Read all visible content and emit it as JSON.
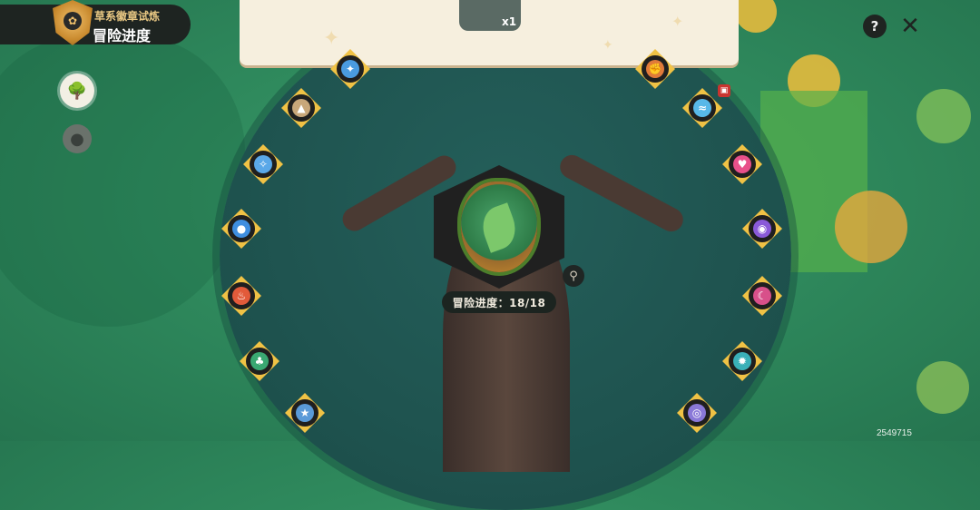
{
  "header": {
    "subtitle": "草系徽章试炼",
    "title": "冒险进度",
    "badge_icon": "leaf-badge-icon"
  },
  "side_menu": {
    "items": [
      {
        "icon": "tree-icon",
        "active": true
      },
      {
        "icon": "pokemon-silhouette-icon",
        "active": false
      }
    ]
  },
  "reward_card": {
    "item_icon": "badge-reward-icon",
    "quantity": "x1"
  },
  "top_controls": {
    "help_label": "?",
    "close_label": "✕"
  },
  "center": {
    "emblem_icon": "grass-badge-emblem",
    "progress_text": "冒险进度：18/18",
    "zoom_icon": "magnifier-icon"
  },
  "nodes": {
    "left": [
      {
        "icon": "electric-icon",
        "color": "#4a9be0"
      },
      {
        "icon": "rock-mountain-icon",
        "color": "#c8a77a"
      },
      {
        "icon": "ice-crystal-icon",
        "color": "#5aa8e8"
      },
      {
        "icon": "water-drop-icon",
        "color": "#3f8ee0"
      },
      {
        "icon": "fire-icon",
        "color": "#e25a3a"
      },
      {
        "icon": "grass-leaf-icon",
        "color": "#3aa872"
      },
      {
        "icon": "normal-star-icon",
        "color": "#5a9ad8"
      }
    ],
    "right": [
      {
        "icon": "fighting-icon",
        "color": "#e07a3a"
      },
      {
        "icon": "flying-icon",
        "color": "#58b8e8"
      },
      {
        "icon": "fairy-heart-icon",
        "color": "#e8508a"
      },
      {
        "icon": "ghost-icon",
        "color": "#8a5ad8"
      },
      {
        "icon": "dark-icon",
        "color": "#d8508a"
      },
      {
        "icon": "steel-gear-icon",
        "color": "#3ab0b8"
      },
      {
        "icon": "psychic-spiral-icon",
        "color": "#8a78d8"
      }
    ],
    "gift_badge_icon": "gift-icon"
  },
  "footer": {
    "uid": "2549715"
  },
  "colors": {
    "background": "#2f8a5d",
    "node_frame": "#f0c245",
    "panel_dark": "#1e2421",
    "card_cream": "#f6efde"
  }
}
